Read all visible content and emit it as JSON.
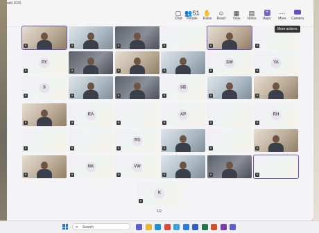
{
  "window": {
    "title": "udit 2025"
  },
  "toolbar": [
    {
      "key": "chat",
      "label": "Chat",
      "icon": "chat-icon",
      "glyph": "▢"
    },
    {
      "key": "people",
      "label": "People",
      "icon": "people-icon",
      "glyph": "👥"
    },
    {
      "key": "raise",
      "label": "Raise",
      "icon": "raise-hand-icon",
      "glyph": "✋"
    },
    {
      "key": "react",
      "label": "React",
      "icon": "react-icon",
      "glyph": "☺"
    },
    {
      "key": "view",
      "label": "View",
      "icon": "view-icon",
      "glyph": "▦"
    },
    {
      "key": "notes",
      "label": "Notes",
      "icon": "notes-icon",
      "glyph": "▤"
    },
    {
      "key": "apps",
      "label": "Apps",
      "icon": "apps-icon",
      "glyph": "+"
    },
    {
      "key": "more",
      "label": "More",
      "icon": "more-icon",
      "glyph": "⋯"
    }
  ],
  "people_count": "51",
  "camera_label": "Camera",
  "tooltip": "More actions",
  "participants": [
    {
      "initials": "",
      "style": "photo warm",
      "active": true
    },
    {
      "initials": "",
      "style": "photo cool"
    },
    {
      "initials": "",
      "style": "photo dark"
    },
    {
      "initials": "",
      "style": "pastel"
    },
    {
      "initials": "",
      "style": "photo warm",
      "active": true
    },
    {
      "initials": "",
      "style": "pastel"
    },
    {
      "initials": "RY",
      "style": "pastel"
    },
    {
      "initials": "",
      "style": "photo dark"
    },
    {
      "initials": "",
      "style": "photo warm"
    },
    {
      "initials": "",
      "style": "photo cool"
    },
    {
      "initials": "SW",
      "style": "pastel"
    },
    {
      "initials": "YA",
      "style": "pastel"
    },
    {
      "initials": "S",
      "style": "pastel"
    },
    {
      "initials": "",
      "style": "photo cool"
    },
    {
      "initials": "",
      "style": "photo dark"
    },
    {
      "initials": "SB",
      "style": "pastel"
    },
    {
      "initials": "",
      "style": "photo cool"
    },
    {
      "initials": "",
      "style": "photo warm"
    },
    {
      "initials": "",
      "style": "photo warm"
    },
    {
      "initials": "RA",
      "style": "pastel"
    },
    {
      "initials": "",
      "style": "pastel"
    },
    {
      "initials": "AP",
      "style": "pastel"
    },
    {
      "initials": "",
      "style": "pastel"
    },
    {
      "initials": "RH",
      "style": "pastel"
    },
    {
      "initials": "",
      "style": "pastel"
    },
    {
      "initials": "",
      "style": "pastel"
    },
    {
      "initials": "RS",
      "style": "pastel"
    },
    {
      "initials": "",
      "style": "photo cool"
    },
    {
      "initials": "",
      "style": "pastel"
    },
    {
      "initials": "",
      "style": "photo warm"
    },
    {
      "initials": "",
      "style": "photo warm"
    },
    {
      "initials": "NK",
      "style": "pastel"
    },
    {
      "initials": "VW",
      "style": "pastel"
    },
    {
      "initials": "",
      "style": "photo cool"
    },
    {
      "initials": "",
      "style": "photo dark"
    },
    {
      "initials": "",
      "style": "pastel",
      "active": true
    },
    {
      "initials": "K",
      "style": "pastel"
    }
  ],
  "pager": "1/2",
  "taskbar": {
    "search_label": "Search",
    "apps": [
      {
        "icon": "teams-icon",
        "color": "#5b5fc7"
      },
      {
        "icon": "file-explorer-icon",
        "color": "#e8b43a"
      },
      {
        "icon": "edge-icon",
        "color": "#1f8fd6"
      },
      {
        "icon": "chrome-icon",
        "color": "#d94a3d"
      },
      {
        "icon": "photos-icon",
        "color": "#3aa0d8"
      },
      {
        "icon": "store-icon",
        "color": "#2f7bd8"
      },
      {
        "icon": "word-icon",
        "color": "#2b5fb8"
      },
      {
        "icon": "excel-icon",
        "color": "#1f7a45"
      },
      {
        "icon": "powerpoint-icon",
        "color": "#d0512b"
      },
      {
        "icon": "onenote-icon",
        "color": "#7a3aa8"
      },
      {
        "icon": "teams-new-icon",
        "color": "#5b5fc7"
      }
    ]
  }
}
